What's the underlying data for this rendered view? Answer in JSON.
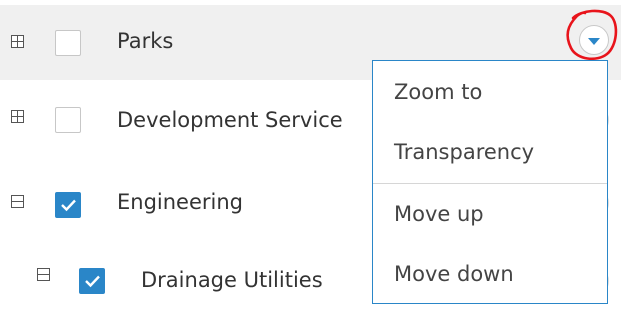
{
  "layers": [
    {
      "label": "Parks",
      "expanded": false,
      "checked": false,
      "highlighted": true
    },
    {
      "label": "Development Service",
      "expanded": false,
      "checked": false
    },
    {
      "label": "Engineering",
      "expanded": true,
      "checked": true
    },
    {
      "label": "Drainage Utilities",
      "expanded": true,
      "checked": true
    }
  ],
  "context_menu": {
    "items": [
      {
        "label": "Zoom to"
      },
      {
        "label": "Transparency"
      },
      {
        "label": "Move up"
      },
      {
        "label": "Move down"
      }
    ]
  },
  "colors": {
    "accent": "#2a86c8",
    "highlight_row": "#f0f0f0",
    "annotation": "#e8141b"
  }
}
